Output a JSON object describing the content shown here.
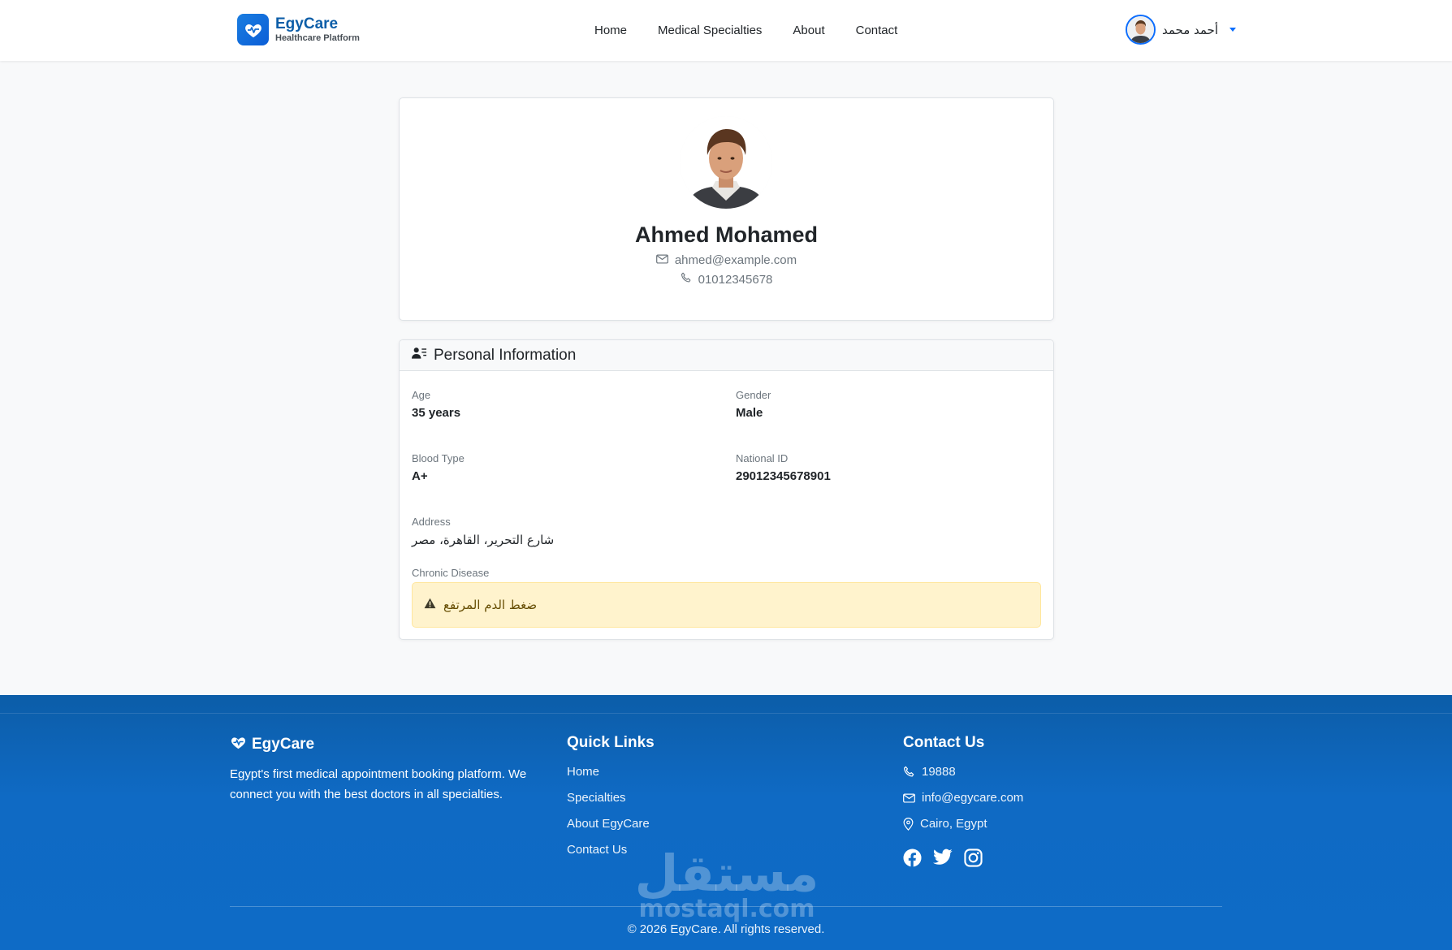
{
  "colors": {
    "primary": "#0d6efd",
    "footer_bg": "#0e6bc6",
    "alert_bg": "#fff3cd",
    "alert_text": "#664d03"
  },
  "navbar": {
    "brand_name": "EgyCare",
    "brand_sub": "Healthcare Platform",
    "links": [
      "Home",
      "Medical Specialties",
      "About",
      "Contact"
    ],
    "user_name": "أحمد محمد"
  },
  "profile": {
    "name": "Ahmed Mohamed",
    "email": "ahmed@example.com",
    "phone": "01012345678"
  },
  "info": {
    "title": "Personal Information",
    "age_label": "Age",
    "age_value": "35 years",
    "gender_label": "Gender",
    "gender_value": "Male",
    "blood_label": "Blood Type",
    "blood_value": "A+",
    "nid_label": "National ID",
    "nid_value": "29012345678901",
    "address_label": "Address",
    "address_value": "شارع التحرير، القاهرة، مصر",
    "chronic_label": "Chronic Disease",
    "chronic_value": "ضغط الدم المرتفع"
  },
  "footer": {
    "brand": "EgyCare",
    "description": "Egypt's first medical appointment booking platform. We connect you with the best doctors in all specialties.",
    "quick_links_title": "Quick Links",
    "quick_links": [
      "Home",
      "Specialties",
      "About EgyCare",
      "Contact Us"
    ],
    "contact_title": "Contact Us",
    "phone": "19888",
    "email": "info@egycare.com",
    "location": "Cairo, Egypt",
    "copyright": "© 2026 EgyCare. All rights reserved.",
    "watermark_ar": "مستقل",
    "watermark_en": "mostaql.com"
  },
  "icons": [
    "heart-pulse-icon",
    "envelope-icon",
    "telephone-icon",
    "person-lines-icon",
    "warning-triangle-icon",
    "geo-pin-icon",
    "facebook-icon",
    "twitter-icon",
    "instagram-icon"
  ]
}
